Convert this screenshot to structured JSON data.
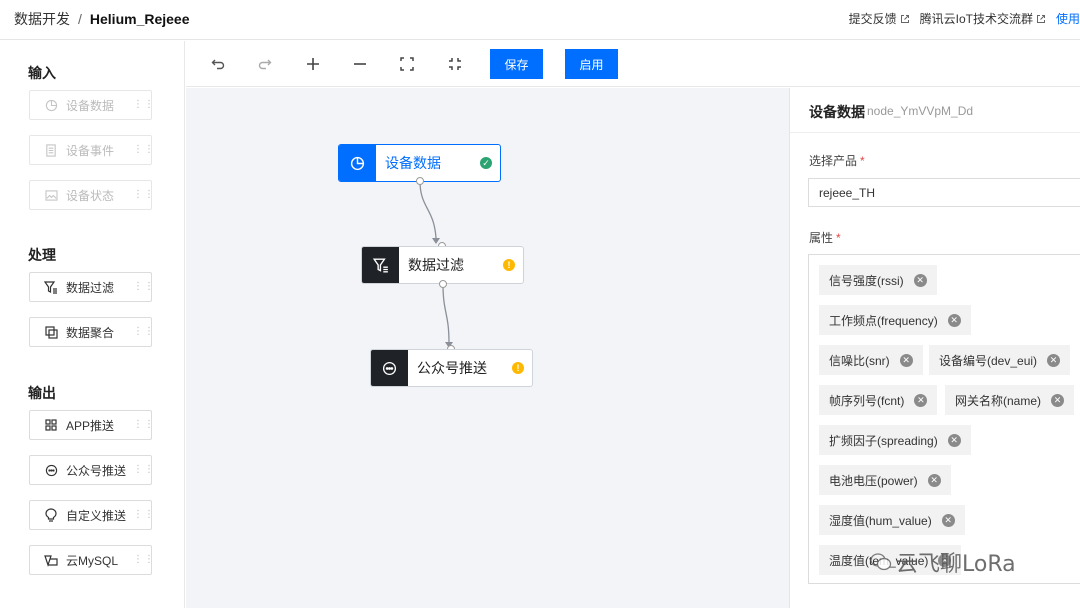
{
  "header": {
    "breadcrumb_root": "数据开发",
    "breadcrumb_sep": "/",
    "project_name": "Helium_Rejeee",
    "link_feedback": "提交反馈",
    "link_community": "腾讯云IoT技术交流群",
    "link_help": "使用"
  },
  "palette": {
    "groups": [
      {
        "title": "输入",
        "items": [
          {
            "label": "设备数据",
            "icon": "pie-chart-icon",
            "disabled": true
          },
          {
            "label": "设备事件",
            "icon": "document-icon",
            "disabled": true
          },
          {
            "label": "设备状态",
            "icon": "image-icon",
            "disabled": true
          }
        ]
      },
      {
        "title": "处理",
        "items": [
          {
            "label": "数据过滤",
            "icon": "filter-icon",
            "disabled": false
          },
          {
            "label": "数据聚合",
            "icon": "copy-icon",
            "disabled": false
          }
        ]
      },
      {
        "title": "输出",
        "items": [
          {
            "label": "APP推送",
            "icon": "grid-icon",
            "disabled": false
          },
          {
            "label": "公众号推送",
            "icon": "chat-bubble-icon",
            "disabled": false
          },
          {
            "label": "自定义推送",
            "icon": "bulb-icon",
            "disabled": false
          },
          {
            "label": "云MySQL",
            "icon": "database-icon",
            "disabled": false
          }
        ]
      }
    ]
  },
  "toolbar": {
    "save_label": "保存",
    "enable_label": "启用"
  },
  "canvas": {
    "nodes": [
      {
        "label": "设备数据",
        "icon": "pie-chart-icon",
        "status": "success",
        "active": true
      },
      {
        "label": "数据过滤",
        "icon": "filter-icon",
        "status": "warning",
        "active": false
      },
      {
        "label": "公众号推送",
        "icon": "chat-bubble-icon",
        "status": "warning",
        "active": false
      }
    ]
  },
  "panel": {
    "title": "设备数据",
    "node_id": "node_YmVVpM_Dd",
    "product_label": "选择产品",
    "product_value": "rejeee_TH",
    "attr_label": "属性",
    "required_mark": "*",
    "attributes": [
      "信号强度(rssi)",
      "工作频点(frequency)",
      "信噪比(snr)",
      "设备编号(dev_eui)",
      "帧序列号(fcnt)",
      "网关名称(name)",
      "扩频因子(spreading)",
      "电池电压(power)",
      "湿度值(hum_value)",
      "温度值(tem_value)"
    ]
  },
  "watermark": {
    "text": "云飞聊LoRa"
  },
  "colors": {
    "primary": "#006eff",
    "success": "#2ba471",
    "warning": "#ffb800",
    "node_dark": "#1f2227"
  }
}
